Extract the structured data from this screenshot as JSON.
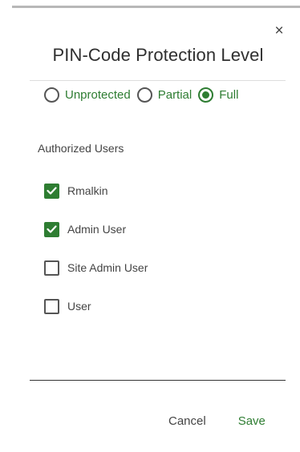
{
  "dialog": {
    "title": "PIN-Code Protection Level",
    "close_symbol": "×",
    "close_icon": "close-icon"
  },
  "protection": {
    "options": [
      {
        "label": "Unprotected",
        "selected": false
      },
      {
        "label": "Partial",
        "selected": false
      },
      {
        "label": "Full",
        "selected": true
      }
    ]
  },
  "authorized_users": {
    "label": "Authorized Users",
    "users": [
      {
        "label": "Rmalkin",
        "checked": true
      },
      {
        "label": "Admin User",
        "checked": true
      },
      {
        "label": "Site Admin User",
        "checked": false
      },
      {
        "label": "User",
        "checked": false
      }
    ]
  },
  "footer": {
    "cancel_label": "Cancel",
    "save_label": "Save"
  },
  "colors": {
    "accent": "#2e7d32",
    "text": "#444444",
    "divider": "#dddddd"
  }
}
